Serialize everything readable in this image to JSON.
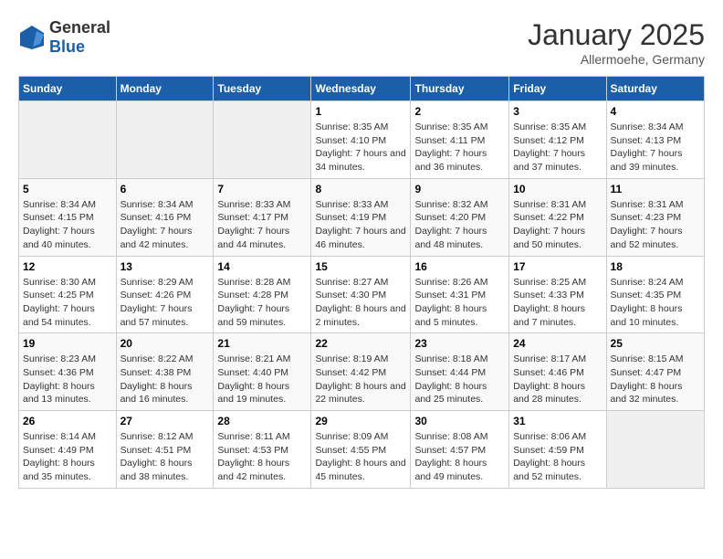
{
  "header": {
    "logo_general": "General",
    "logo_blue": "Blue",
    "month": "January 2025",
    "location": "Allermoehe, Germany"
  },
  "weekdays": [
    "Sunday",
    "Monday",
    "Tuesday",
    "Wednesday",
    "Thursday",
    "Friday",
    "Saturday"
  ],
  "weeks": [
    [
      {
        "day": "",
        "empty": true
      },
      {
        "day": "",
        "empty": true
      },
      {
        "day": "",
        "empty": true
      },
      {
        "day": "1",
        "sunrise": "8:35 AM",
        "sunset": "4:10 PM",
        "daylight": "7 hours and 34 minutes."
      },
      {
        "day": "2",
        "sunrise": "8:35 AM",
        "sunset": "4:11 PM",
        "daylight": "7 hours and 36 minutes."
      },
      {
        "day": "3",
        "sunrise": "8:35 AM",
        "sunset": "4:12 PM",
        "daylight": "7 hours and 37 minutes."
      },
      {
        "day": "4",
        "sunrise": "8:34 AM",
        "sunset": "4:13 PM",
        "daylight": "7 hours and 39 minutes."
      }
    ],
    [
      {
        "day": "5",
        "sunrise": "8:34 AM",
        "sunset": "4:15 PM",
        "daylight": "7 hours and 40 minutes."
      },
      {
        "day": "6",
        "sunrise": "8:34 AM",
        "sunset": "4:16 PM",
        "daylight": "7 hours and 42 minutes."
      },
      {
        "day": "7",
        "sunrise": "8:33 AM",
        "sunset": "4:17 PM",
        "daylight": "7 hours and 44 minutes."
      },
      {
        "day": "8",
        "sunrise": "8:33 AM",
        "sunset": "4:19 PM",
        "daylight": "7 hours and 46 minutes."
      },
      {
        "day": "9",
        "sunrise": "8:32 AM",
        "sunset": "4:20 PM",
        "daylight": "7 hours and 48 minutes."
      },
      {
        "day": "10",
        "sunrise": "8:31 AM",
        "sunset": "4:22 PM",
        "daylight": "7 hours and 50 minutes."
      },
      {
        "day": "11",
        "sunrise": "8:31 AM",
        "sunset": "4:23 PM",
        "daylight": "7 hours and 52 minutes."
      }
    ],
    [
      {
        "day": "12",
        "sunrise": "8:30 AM",
        "sunset": "4:25 PM",
        "daylight": "7 hours and 54 minutes."
      },
      {
        "day": "13",
        "sunrise": "8:29 AM",
        "sunset": "4:26 PM",
        "daylight": "7 hours and 57 minutes."
      },
      {
        "day": "14",
        "sunrise": "8:28 AM",
        "sunset": "4:28 PM",
        "daylight": "7 hours and 59 minutes."
      },
      {
        "day": "15",
        "sunrise": "8:27 AM",
        "sunset": "4:30 PM",
        "daylight": "8 hours and 2 minutes."
      },
      {
        "day": "16",
        "sunrise": "8:26 AM",
        "sunset": "4:31 PM",
        "daylight": "8 hours and 5 minutes."
      },
      {
        "day": "17",
        "sunrise": "8:25 AM",
        "sunset": "4:33 PM",
        "daylight": "8 hours and 7 minutes."
      },
      {
        "day": "18",
        "sunrise": "8:24 AM",
        "sunset": "4:35 PM",
        "daylight": "8 hours and 10 minutes."
      }
    ],
    [
      {
        "day": "19",
        "sunrise": "8:23 AM",
        "sunset": "4:36 PM",
        "daylight": "8 hours and 13 minutes."
      },
      {
        "day": "20",
        "sunrise": "8:22 AM",
        "sunset": "4:38 PM",
        "daylight": "8 hours and 16 minutes."
      },
      {
        "day": "21",
        "sunrise": "8:21 AM",
        "sunset": "4:40 PM",
        "daylight": "8 hours and 19 minutes."
      },
      {
        "day": "22",
        "sunrise": "8:19 AM",
        "sunset": "4:42 PM",
        "daylight": "8 hours and 22 minutes."
      },
      {
        "day": "23",
        "sunrise": "8:18 AM",
        "sunset": "4:44 PM",
        "daylight": "8 hours and 25 minutes."
      },
      {
        "day": "24",
        "sunrise": "8:17 AM",
        "sunset": "4:46 PM",
        "daylight": "8 hours and 28 minutes."
      },
      {
        "day": "25",
        "sunrise": "8:15 AM",
        "sunset": "4:47 PM",
        "daylight": "8 hours and 32 minutes."
      }
    ],
    [
      {
        "day": "26",
        "sunrise": "8:14 AM",
        "sunset": "4:49 PM",
        "daylight": "8 hours and 35 minutes."
      },
      {
        "day": "27",
        "sunrise": "8:12 AM",
        "sunset": "4:51 PM",
        "daylight": "8 hours and 38 minutes."
      },
      {
        "day": "28",
        "sunrise": "8:11 AM",
        "sunset": "4:53 PM",
        "daylight": "8 hours and 42 minutes."
      },
      {
        "day": "29",
        "sunrise": "8:09 AM",
        "sunset": "4:55 PM",
        "daylight": "8 hours and 45 minutes."
      },
      {
        "day": "30",
        "sunrise": "8:08 AM",
        "sunset": "4:57 PM",
        "daylight": "8 hours and 49 minutes."
      },
      {
        "day": "31",
        "sunrise": "8:06 AM",
        "sunset": "4:59 PM",
        "daylight": "8 hours and 52 minutes."
      },
      {
        "day": "",
        "empty": true
      }
    ]
  ]
}
